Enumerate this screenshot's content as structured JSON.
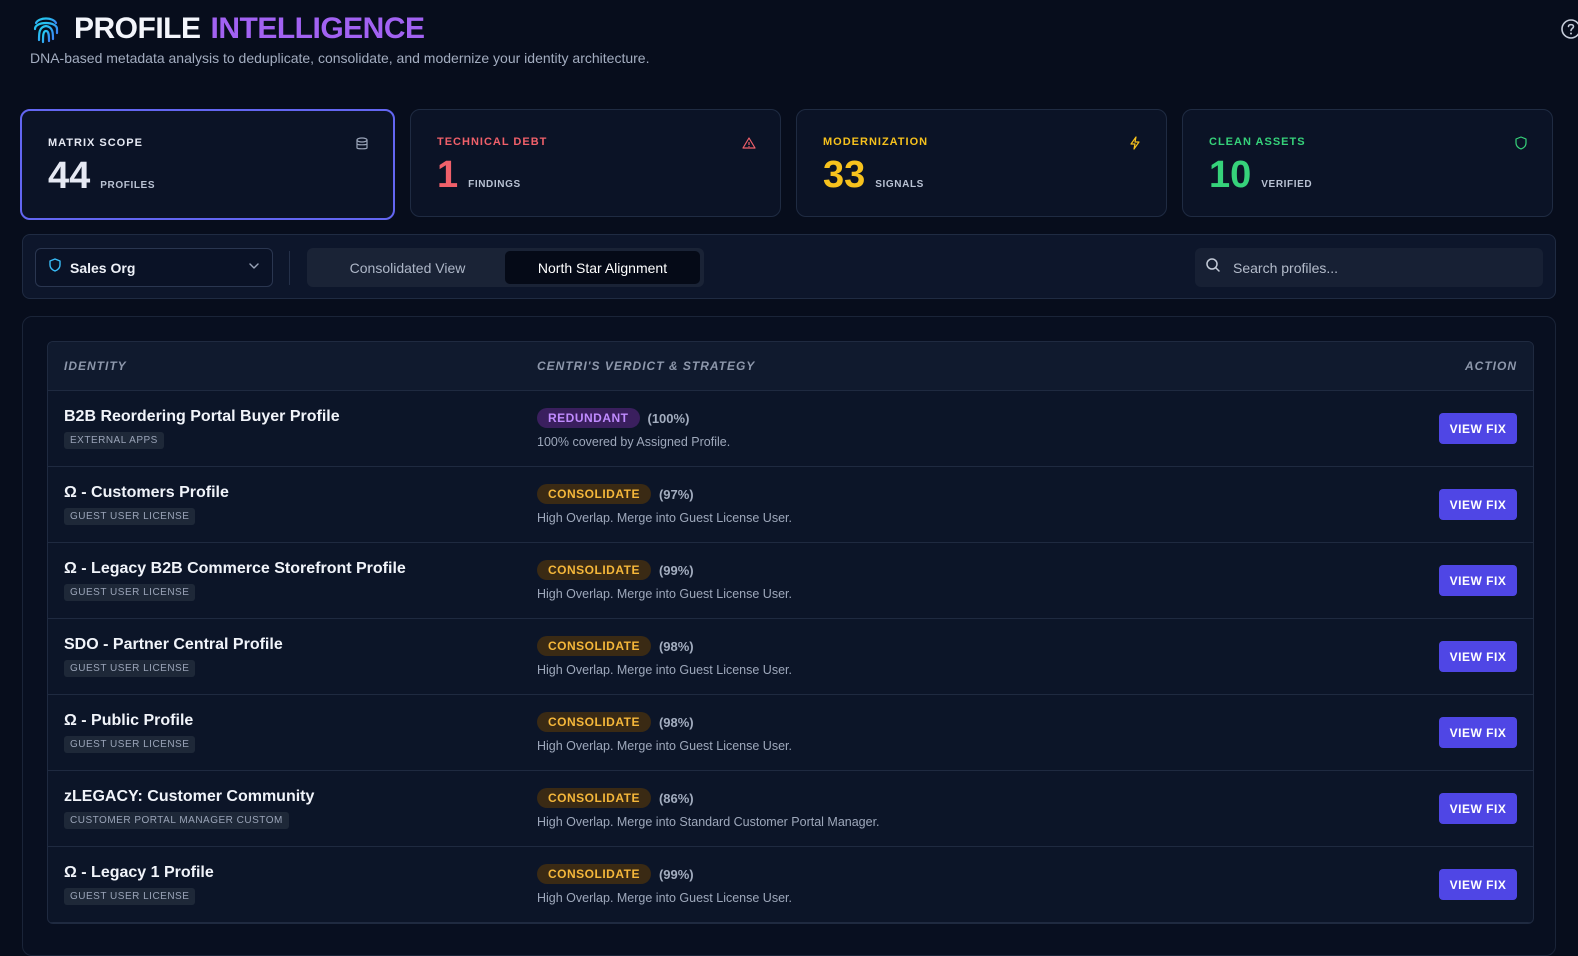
{
  "header": {
    "title_part1": "PROFILE",
    "title_part2": "INTELLIGENCE",
    "subtitle": "DNA-based metadata analysis to deduplicate, consolidate, and modernize your identity architecture."
  },
  "stats": [
    {
      "label": "MATRIX SCOPE",
      "value": "44",
      "unit": "PROFILES",
      "color": "#e6e9f3",
      "icon": "database-icon"
    },
    {
      "label": "TECHNICAL DEBT",
      "value": "1",
      "unit": "FINDINGS",
      "color": "#f0606a",
      "icon": "warning-icon"
    },
    {
      "label": "MODERNIZATION",
      "value": "33",
      "unit": "SIGNALS",
      "color": "#f7c21d",
      "icon": "bolt-icon"
    },
    {
      "label": "CLEAN ASSETS",
      "value": "10",
      "unit": "VERIFIED",
      "color": "#36d27a",
      "icon": "shield-icon"
    }
  ],
  "toolbar": {
    "org_label": "Sales Org",
    "tab_consolidated": "Consolidated View",
    "tab_north_star": "North Star Alignment",
    "search_placeholder": "Search profiles..."
  },
  "table": {
    "headers": {
      "identity": "IDENTITY",
      "verdict": "CENTRI'S VERDICT & STRATEGY",
      "action": "ACTION"
    },
    "rows": [
      {
        "name": "B2B Reordering Portal Buyer Profile",
        "tag": "EXTERNAL APPS",
        "verdict": "REDUNDANT",
        "pct": "(100%)",
        "strategy": "100% covered by Assigned Profile.",
        "action": "VIEW FIX"
      },
      {
        "name": "Ω - Customers Profile",
        "tag": "GUEST USER LICENSE",
        "verdict": "CONSOLIDATE",
        "pct": "(97%)",
        "strategy": "High Overlap. Merge into Guest License User.",
        "action": "VIEW FIX"
      },
      {
        "name": "Ω - Legacy B2B Commerce Storefront Profile",
        "tag": "GUEST USER LICENSE",
        "verdict": "CONSOLIDATE",
        "pct": "(99%)",
        "strategy": "High Overlap. Merge into Guest License User.",
        "action": "VIEW FIX"
      },
      {
        "name": "SDO - Partner Central Profile",
        "tag": "GUEST USER LICENSE",
        "verdict": "CONSOLIDATE",
        "pct": "(98%)",
        "strategy": "High Overlap. Merge into Guest License User.",
        "action": "VIEW FIX"
      },
      {
        "name": "Ω - Public Profile",
        "tag": "GUEST USER LICENSE",
        "verdict": "CONSOLIDATE",
        "pct": "(98%)",
        "strategy": "High Overlap. Merge into Guest License User.",
        "action": "VIEW FIX"
      },
      {
        "name": "zLEGACY: Customer Community",
        "tag": "CUSTOMER PORTAL MANAGER CUSTOM",
        "verdict": "CONSOLIDATE",
        "pct": "(86%)",
        "strategy": "High Overlap. Merge into Standard Customer Portal Manager.",
        "action": "VIEW FIX"
      },
      {
        "name": "Ω - Legacy 1 Profile",
        "tag": "GUEST USER LICENSE",
        "verdict": "CONSOLIDATE",
        "pct": "(99%)",
        "strategy": "High Overlap. Merge into Guest License User.",
        "action": "VIEW FIX"
      }
    ]
  }
}
